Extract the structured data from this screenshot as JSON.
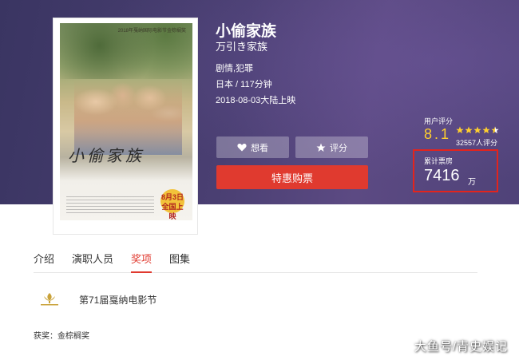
{
  "movie": {
    "title": "小偷家族",
    "original_title": "万引き家族",
    "genre": "剧情,犯罪",
    "country_duration": "日本 / 117分钟",
    "release": "2018-08-03大陆上映"
  },
  "poster": {
    "festival_text": "2018年戛纳国际电影节金棕榈奖",
    "title_calligraphy": "小偷家族",
    "date_badge": "8月3日 全国上映"
  },
  "actions": {
    "want_label": "想看",
    "rate_label": "评分",
    "buy_label": "特惠购票"
  },
  "rating": {
    "label": "用户评分",
    "value": "8.1",
    "stars_filled": 4.5,
    "count": "32557人评分"
  },
  "boxoffice": {
    "label": "累计票房",
    "value": "7416",
    "unit": "万"
  },
  "tabs": [
    {
      "label": "介绍"
    },
    {
      "label": "演职人员"
    },
    {
      "label": "奖项"
    },
    {
      "label": "图集"
    }
  ],
  "awards": {
    "festival_name": "第71届戛纳电影节",
    "award_text": "获奖：金棕榈奖"
  },
  "watermark": "大鱼号/青史娱记",
  "colors": {
    "accent_red": "#e03a2f",
    "rating_gold": "#ffcf2e",
    "banner_purple": "#4a3f72"
  }
}
